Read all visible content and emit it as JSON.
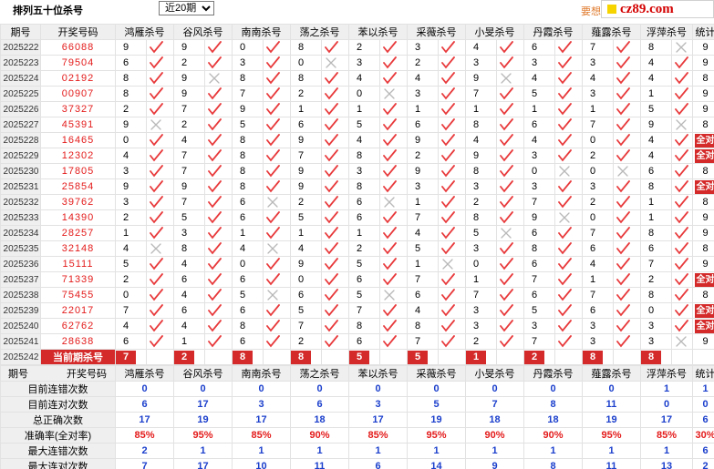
{
  "page": {
    "title": "排列五十位杀号",
    "period_select": "近20期",
    "promo": "要想中大"
  },
  "site_badge": {
    "text": "cz89.com"
  },
  "columns": [
    "期号",
    "开奖号码",
    "鸿雁杀号",
    "谷风杀号",
    "南南杀号",
    "荡之杀号",
    "苯以杀号",
    "采薇杀号",
    "小旻杀号",
    "丹霞杀号",
    "薤露杀号",
    "浮萍杀号",
    "统计"
  ],
  "rows": [
    {
      "issue": "2025222",
      "win": "66088",
      "kills": [
        [
          9,
          1
        ],
        [
          9,
          1
        ],
        [
          0,
          1
        ],
        [
          8,
          1
        ],
        [
          2,
          1
        ],
        [
          3,
          1
        ],
        [
          4,
          1
        ],
        [
          6,
          1
        ],
        [
          7,
          1
        ],
        [
          8,
          0
        ]
      ],
      "stat": "9"
    },
    {
      "issue": "2025223",
      "win": "79504",
      "kills": [
        [
          6,
          1
        ],
        [
          2,
          1
        ],
        [
          3,
          1
        ],
        [
          0,
          0
        ],
        [
          3,
          1
        ],
        [
          2,
          1
        ],
        [
          3,
          1
        ],
        [
          3,
          1
        ],
        [
          3,
          1
        ],
        [
          4,
          1
        ]
      ],
      "stat": "9"
    },
    {
      "issue": "2025224",
      "win": "02192",
      "kills": [
        [
          8,
          1
        ],
        [
          9,
          0
        ],
        [
          8,
          1
        ],
        [
          8,
          1
        ],
        [
          4,
          1
        ],
        [
          4,
          1
        ],
        [
          9,
          0
        ],
        [
          4,
          1
        ],
        [
          4,
          1
        ],
        [
          4,
          1
        ]
      ],
      "stat": "8"
    },
    {
      "issue": "2025225",
      "win": "00907",
      "kills": [
        [
          8,
          1
        ],
        [
          9,
          1
        ],
        [
          7,
          1
        ],
        [
          2,
          1
        ],
        [
          0,
          0
        ],
        [
          3,
          1
        ],
        [
          7,
          1
        ],
        [
          5,
          1
        ],
        [
          3,
          1
        ],
        [
          1,
          1
        ]
      ],
      "stat": "9"
    },
    {
      "issue": "2025226",
      "win": "37327",
      "kills": [
        [
          2,
          1
        ],
        [
          7,
          1
        ],
        [
          9,
          1
        ],
        [
          1,
          1
        ],
        [
          1,
          1
        ],
        [
          1,
          1
        ],
        [
          1,
          1
        ],
        [
          1,
          1
        ],
        [
          1,
          1
        ],
        [
          5,
          1
        ]
      ],
      "stat": "9"
    },
    {
      "issue": "2025227",
      "win": "45391",
      "kills": [
        [
          9,
          0
        ],
        [
          2,
          1
        ],
        [
          5,
          1
        ],
        [
          6,
          1
        ],
        [
          5,
          1
        ],
        [
          6,
          1
        ],
        [
          8,
          1
        ],
        [
          6,
          1
        ],
        [
          7,
          1
        ],
        [
          9,
          0
        ]
      ],
      "stat": "8"
    },
    {
      "issue": "2025228",
      "win": "16465",
      "kills": [
        [
          0,
          1
        ],
        [
          4,
          1
        ],
        [
          8,
          1
        ],
        [
          9,
          1
        ],
        [
          4,
          1
        ],
        [
          9,
          1
        ],
        [
          4,
          1
        ],
        [
          4,
          1
        ],
        [
          0,
          1
        ],
        [
          4,
          1
        ]
      ],
      "stat": "全对"
    },
    {
      "issue": "2025229",
      "win": "12302",
      "kills": [
        [
          4,
          1
        ],
        [
          7,
          1
        ],
        [
          8,
          1
        ],
        [
          7,
          1
        ],
        [
          8,
          1
        ],
        [
          2,
          1
        ],
        [
          9,
          1
        ],
        [
          3,
          1
        ],
        [
          2,
          1
        ],
        [
          4,
          1
        ]
      ],
      "stat": "全对"
    },
    {
      "issue": "2025230",
      "win": "17805",
      "kills": [
        [
          3,
          1
        ],
        [
          7,
          1
        ],
        [
          8,
          1
        ],
        [
          9,
          1
        ],
        [
          3,
          1
        ],
        [
          9,
          1
        ],
        [
          8,
          1
        ],
        [
          0,
          0
        ],
        [
          0,
          0
        ],
        [
          6,
          1
        ]
      ],
      "stat": "8"
    },
    {
      "issue": "2025231",
      "win": "25854",
      "kills": [
        [
          9,
          1
        ],
        [
          9,
          1
        ],
        [
          8,
          1
        ],
        [
          9,
          1
        ],
        [
          8,
          1
        ],
        [
          3,
          1
        ],
        [
          3,
          1
        ],
        [
          3,
          1
        ],
        [
          3,
          1
        ],
        [
          8,
          1
        ]
      ],
      "stat": "全对"
    },
    {
      "issue": "2025232",
      "win": "39762",
      "kills": [
        [
          3,
          1
        ],
        [
          7,
          1
        ],
        [
          6,
          0
        ],
        [
          2,
          1
        ],
        [
          6,
          0
        ],
        [
          1,
          1
        ],
        [
          2,
          1
        ],
        [
          7,
          1
        ],
        [
          2,
          1
        ],
        [
          1,
          1
        ]
      ],
      "stat": "8"
    },
    {
      "issue": "2025233",
      "win": "14390",
      "kills": [
        [
          2,
          1
        ],
        [
          5,
          1
        ],
        [
          6,
          1
        ],
        [
          5,
          1
        ],
        [
          6,
          1
        ],
        [
          7,
          1
        ],
        [
          8,
          1
        ],
        [
          9,
          0
        ],
        [
          0,
          1
        ],
        [
          1,
          1
        ]
      ],
      "stat": "9"
    },
    {
      "issue": "2025234",
      "win": "28257",
      "kills": [
        [
          1,
          1
        ],
        [
          3,
          1
        ],
        [
          1,
          1
        ],
        [
          1,
          1
        ],
        [
          1,
          1
        ],
        [
          4,
          1
        ],
        [
          5,
          0
        ],
        [
          6,
          1
        ],
        [
          7,
          1
        ],
        [
          8,
          1
        ]
      ],
      "stat": "9"
    },
    {
      "issue": "2025235",
      "win": "32148",
      "kills": [
        [
          4,
          0
        ],
        [
          8,
          1
        ],
        [
          4,
          0
        ],
        [
          4,
          1
        ],
        [
          2,
          1
        ],
        [
          5,
          1
        ],
        [
          3,
          1
        ],
        [
          8,
          1
        ],
        [
          6,
          1
        ],
        [
          6,
          1
        ]
      ],
      "stat": "8"
    },
    {
      "issue": "2025236",
      "win": "15111",
      "kills": [
        [
          5,
          1
        ],
        [
          4,
          1
        ],
        [
          0,
          1
        ],
        [
          9,
          1
        ],
        [
          5,
          1
        ],
        [
          1,
          0
        ],
        [
          0,
          1
        ],
        [
          6,
          1
        ],
        [
          4,
          1
        ],
        [
          7,
          1
        ]
      ],
      "stat": "9"
    },
    {
      "issue": "2025237",
      "win": "71339",
      "kills": [
        [
          2,
          1
        ],
        [
          6,
          1
        ],
        [
          6,
          1
        ],
        [
          0,
          1
        ],
        [
          6,
          1
        ],
        [
          7,
          1
        ],
        [
          1,
          1
        ],
        [
          7,
          1
        ],
        [
          1,
          1
        ],
        [
          2,
          1
        ]
      ],
      "stat": "全对"
    },
    {
      "issue": "2025238",
      "win": "75455",
      "kills": [
        [
          0,
          1
        ],
        [
          4,
          1
        ],
        [
          5,
          0
        ],
        [
          6,
          1
        ],
        [
          5,
          0
        ],
        [
          6,
          1
        ],
        [
          7,
          1
        ],
        [
          6,
          1
        ],
        [
          7,
          1
        ],
        [
          8,
          1
        ]
      ],
      "stat": "8"
    },
    {
      "issue": "2025239",
      "win": "22017",
      "kills": [
        [
          7,
          1
        ],
        [
          6,
          1
        ],
        [
          6,
          1
        ],
        [
          5,
          1
        ],
        [
          7,
          1
        ],
        [
          4,
          1
        ],
        [
          3,
          1
        ],
        [
          5,
          1
        ],
        [
          6,
          1
        ],
        [
          0,
          1
        ]
      ],
      "stat": "全对"
    },
    {
      "issue": "2025240",
      "win": "62762",
      "kills": [
        [
          4,
          1
        ],
        [
          4,
          1
        ],
        [
          8,
          1
        ],
        [
          7,
          1
        ],
        [
          8,
          1
        ],
        [
          8,
          1
        ],
        [
          3,
          1
        ],
        [
          3,
          1
        ],
        [
          3,
          1
        ],
        [
          3,
          1
        ]
      ],
      "stat": "全对"
    },
    {
      "issue": "2025241",
      "win": "28638",
      "kills": [
        [
          6,
          1
        ],
        [
          1,
          1
        ],
        [
          6,
          1
        ],
        [
          2,
          1
        ],
        [
          6,
          1
        ],
        [
          7,
          1
        ],
        [
          2,
          1
        ],
        [
          7,
          1
        ],
        [
          3,
          1
        ],
        [
          3,
          0
        ]
      ],
      "stat": "9"
    }
  ],
  "current": {
    "issue": "2025242",
    "label": "当前期杀号",
    "kills": [
      "7",
      "2",
      "8",
      "8",
      "5",
      "5",
      "1",
      "2",
      "8",
      "8"
    ]
  },
  "stats_header": [
    "期号",
    "开奖号码",
    "鸿雁杀号",
    "谷风杀号",
    "南南杀号",
    "荡之杀号",
    "苯以杀号",
    "采薇杀号",
    "小旻杀号",
    "丹霞杀号",
    "薤露杀号",
    "浮萍杀号",
    "统计"
  ],
  "stats": [
    {
      "label": "目前连错次数",
      "values": [
        "0",
        "0",
        "0",
        "0",
        "0",
        "0",
        "0",
        "0",
        "0",
        "1",
        "1"
      ],
      "red": false
    },
    {
      "label": "目前连对次数",
      "values": [
        "6",
        "17",
        "3",
        "6",
        "3",
        "5",
        "7",
        "8",
        "11",
        "0",
        "0"
      ],
      "red": false
    },
    {
      "label": "总正确次数",
      "values": [
        "17",
        "19",
        "17",
        "18",
        "17",
        "19",
        "18",
        "18",
        "19",
        "17",
        "6"
      ],
      "red": false
    },
    {
      "label": "准确率(全对率)",
      "values": [
        "85%",
        "95%",
        "85%",
        "90%",
        "85%",
        "95%",
        "90%",
        "90%",
        "95%",
        "85%",
        "30%"
      ],
      "red": true
    },
    {
      "label": "最大连错次数",
      "values": [
        "2",
        "1",
        "1",
        "1",
        "1",
        "1",
        "1",
        "1",
        "1",
        "1",
        "6"
      ],
      "red": false
    },
    {
      "label": "最大连对次数",
      "values": [
        "7",
        "17",
        "10",
        "11",
        "6",
        "14",
        "9",
        "8",
        "11",
        "13",
        "2"
      ],
      "red": false
    }
  ],
  "colors": {
    "accent_red": "#d42a2a",
    "win_red": "#e41b1b",
    "check_red": "#e8393b",
    "cross_gray": "#b8b8b8",
    "stat_blue": "#1b3fcc",
    "header_gray": "#efefef"
  }
}
